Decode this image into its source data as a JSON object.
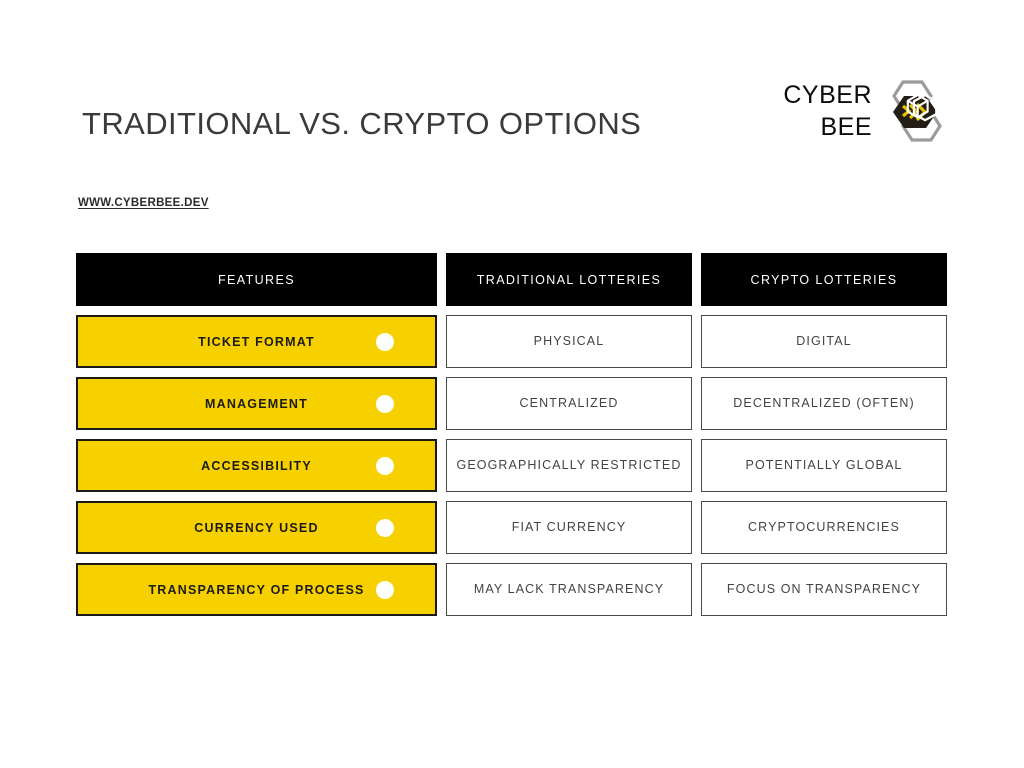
{
  "slide": {
    "title": "TRADITIONAL VS. CRYPTO OPTIONS",
    "url": "WWW.CYBERBEE.DEV",
    "background_color": "#ffffff"
  },
  "brand": {
    "name": "CYBER\nBEE",
    "logo_icon": "cyberbee-hexagon-cube-logo",
    "logo_colors": {
      "hex_outline": "#9a9a9a",
      "hex_fill": "#231f16",
      "stripe": "#e8c400",
      "cube": "#ffffff"
    }
  },
  "theme": {
    "accent_yellow": "#f7d000",
    "header_black": "#000000",
    "header_text": "#ffffff",
    "cell_border": "#4a4a4a",
    "feature_border": "#1a1a1a",
    "title_color": "#3a3a3a",
    "value_text": "#434343",
    "dot_color": "#ffffff"
  },
  "table": {
    "headers": [
      "FEATURES",
      "TRADITIONAL LOTTERIES",
      "CRYPTO LOTTERIES"
    ],
    "rows": [
      {
        "feature": "TICKET FORMAT",
        "traditional": "PHYSICAL",
        "crypto": "DIGITAL",
        "bullet": "white-dot-icon"
      },
      {
        "feature": "MANAGEMENT",
        "traditional": "CENTRALIZED",
        "crypto": "DECENTRALIZED (OFTEN)",
        "bullet": "white-dot-icon"
      },
      {
        "feature": "ACCESSIBILITY",
        "traditional": "GEOGRAPHICALLY RESTRICTED",
        "crypto": "POTENTIALLY GLOBAL",
        "bullet": "white-dot-icon"
      },
      {
        "feature": "CURRENCY USED",
        "traditional": "FIAT CURRENCY",
        "crypto": "CRYPTOCURRENCIES",
        "bullet": "white-dot-icon"
      },
      {
        "feature": "TRANSPARENCY OF PROCESS",
        "traditional": "MAY LACK TRANSPARENCY",
        "crypto": "FOCUS ON TRANSPARENCY",
        "bullet": "white-dot-icon"
      }
    ]
  }
}
